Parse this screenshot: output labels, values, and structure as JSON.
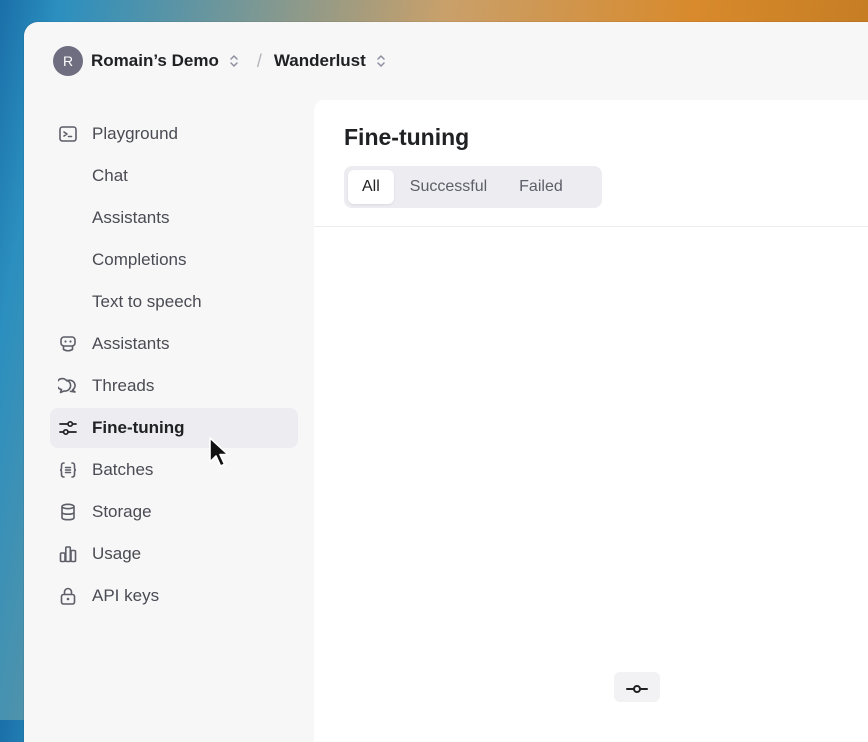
{
  "topbar": {
    "avatar_letter": "R",
    "org_name": "Romain’s Demo",
    "separator": "/",
    "project_name": "Wanderlust"
  },
  "sidebar": {
    "items": [
      {
        "label": "Playground",
        "icon": "terminal-icon",
        "sub": false,
        "active": false
      },
      {
        "label": "Chat",
        "icon": null,
        "sub": true,
        "active": false
      },
      {
        "label": "Assistants",
        "icon": null,
        "sub": true,
        "active": false
      },
      {
        "label": "Completions",
        "icon": null,
        "sub": true,
        "active": false
      },
      {
        "label": "Text to speech",
        "icon": null,
        "sub": true,
        "active": false
      },
      {
        "label": "Assistants",
        "icon": "robot-icon",
        "sub": false,
        "active": false
      },
      {
        "label": "Threads",
        "icon": "chat-bubbles-icon",
        "sub": false,
        "active": false
      },
      {
        "label": "Fine-tuning",
        "icon": "sliders-icon",
        "sub": false,
        "active": true
      },
      {
        "label": "Batches",
        "icon": "braces-icon",
        "sub": false,
        "active": false
      },
      {
        "label": "Storage",
        "icon": "database-icon",
        "sub": false,
        "active": false
      },
      {
        "label": "Usage",
        "icon": "bar-chart-icon",
        "sub": false,
        "active": false
      },
      {
        "label": "API keys",
        "icon": "lock-icon",
        "sub": false,
        "active": false
      }
    ]
  },
  "main": {
    "title": "Fine-tuning",
    "tabs": [
      {
        "label": "All",
        "selected": true
      },
      {
        "label": "Successful",
        "selected": false
      },
      {
        "label": "Failed",
        "selected": false
      }
    ]
  },
  "colors": {
    "active_bg": "#ececf1",
    "text_primary": "#202123",
    "text_secondary": "#4a4b53"
  }
}
